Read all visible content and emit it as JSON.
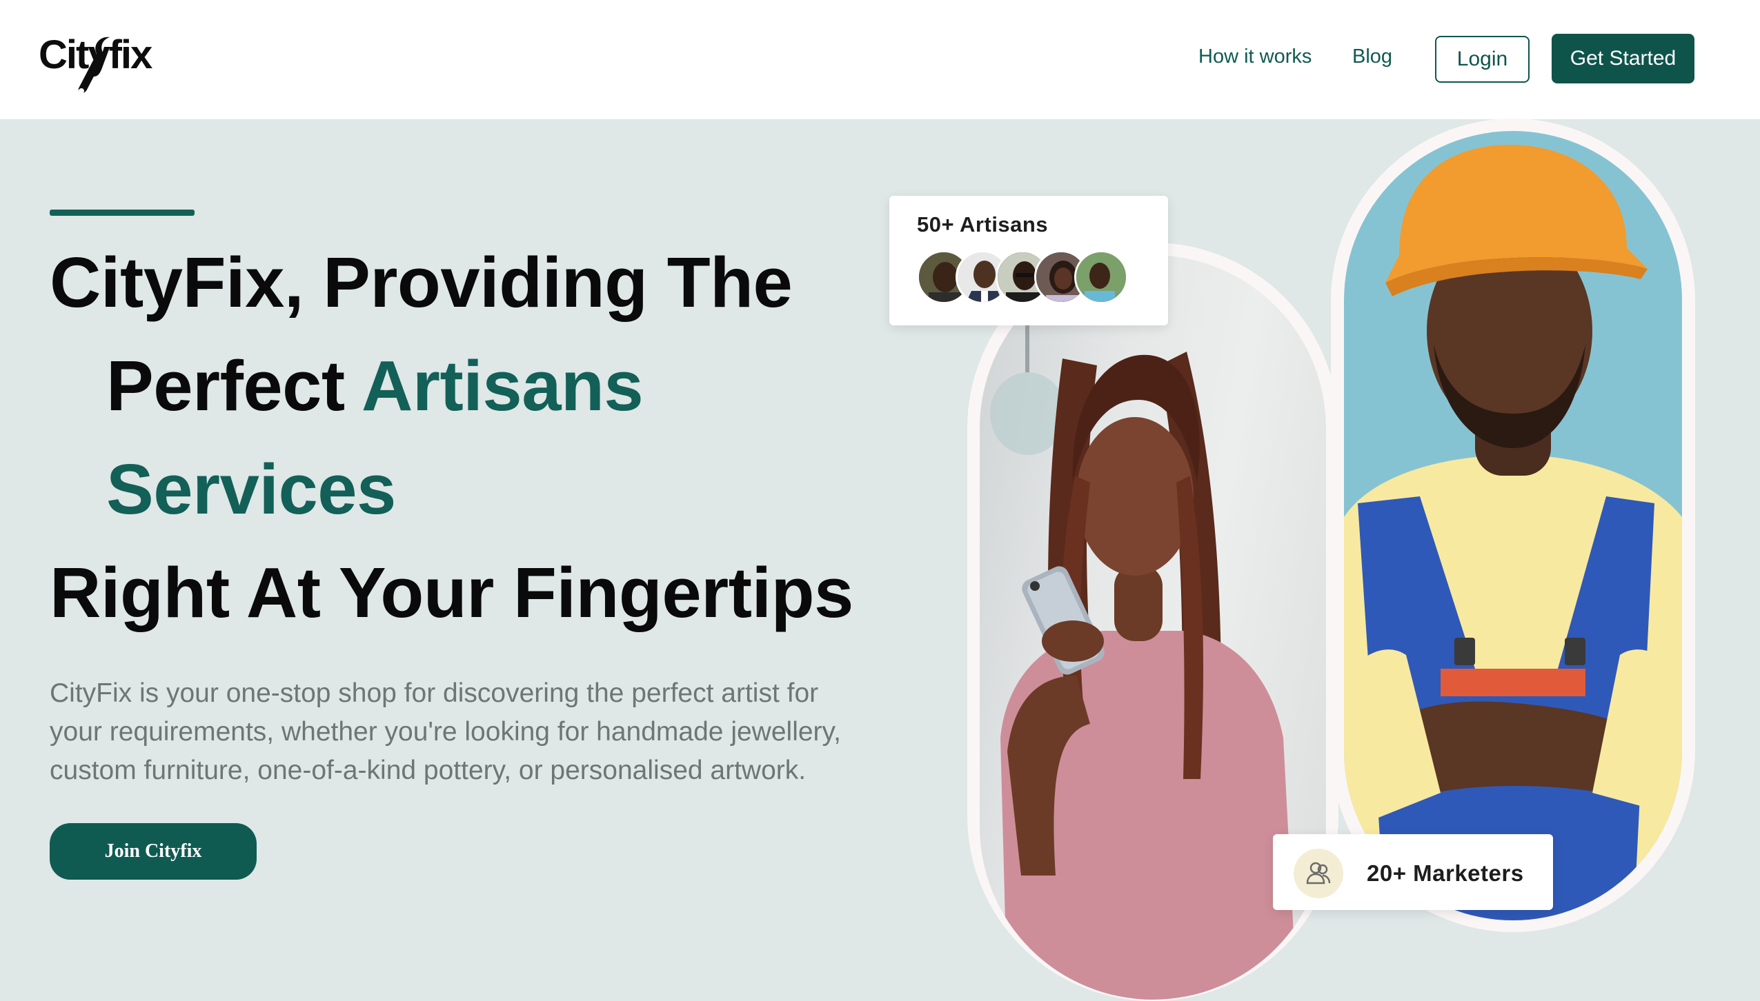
{
  "header": {
    "logo_text": "Cityfix",
    "nav": {
      "how_it_works": "How it works",
      "blog": "Blog"
    },
    "login_label": "Login",
    "get_started_label": "Get Started"
  },
  "hero": {
    "title_line1": "CityFix, Providing The",
    "title_line2_part1": "Perfect ",
    "title_line2_part2": "Artisans",
    "title_line3": "Services",
    "title_line4": "Right At Your Fingertips",
    "description": "CityFix is your one-stop shop for discovering the perfect artist for your requirements, whether you're looking for handmade jewellery, custom furniture, one-of-a-kind pottery, or personalised artwork.",
    "cta_label": "Join Cityfix"
  },
  "stats": {
    "artisans_label": "50+ Artisans",
    "marketers_label": "20+ Marketers"
  },
  "images": {
    "woman": "woman-with-phone-photo",
    "man": "worker-in-hard-hat-photo",
    "avatars": [
      "avatar-1",
      "avatar-2",
      "avatar-3",
      "avatar-4",
      "avatar-5"
    ]
  },
  "colors": {
    "brand": "#0f5b52",
    "hero_background": "#dfe7e7",
    "accent_text": "#126057"
  }
}
